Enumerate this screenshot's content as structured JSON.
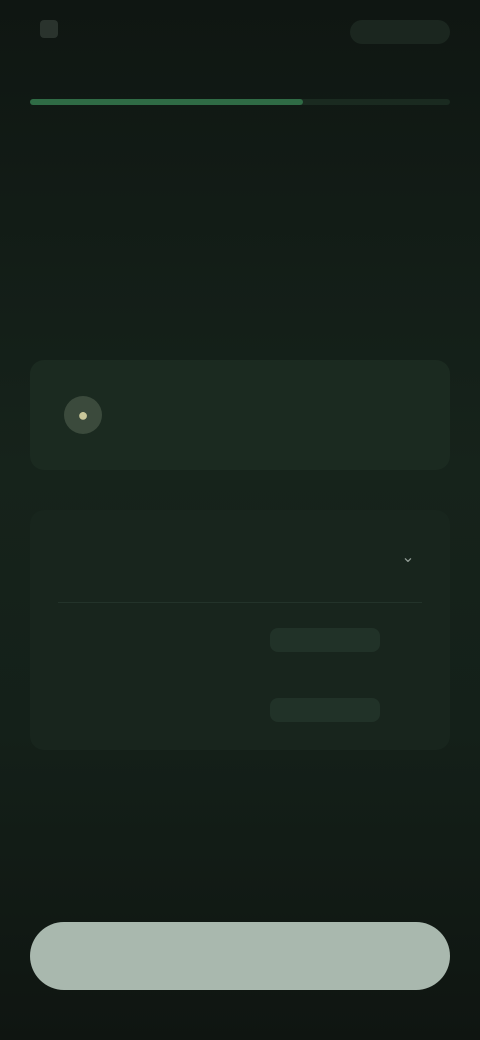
{
  "header": {
    "back_icon": "chevron-left-icon",
    "brand_text": "",
    "action_label": ""
  },
  "progress": {
    "fraction": 0.65
  },
  "heading": {
    "title": "",
    "subtitle": ""
  },
  "notice": {
    "icon": "lightbulb-icon",
    "title": "",
    "body": ""
  },
  "settings": {
    "rows": [
      {
        "label": "",
        "value": "",
        "chevron_icon": "chevron-down-icon"
      },
      {
        "label": "",
        "value": ""
      },
      {
        "label": "",
        "value": ""
      }
    ]
  },
  "cta": {
    "label": ""
  },
  "colors": {
    "background": "#111a15",
    "accent": "#2f6b45",
    "button": "#a9b8ae"
  }
}
